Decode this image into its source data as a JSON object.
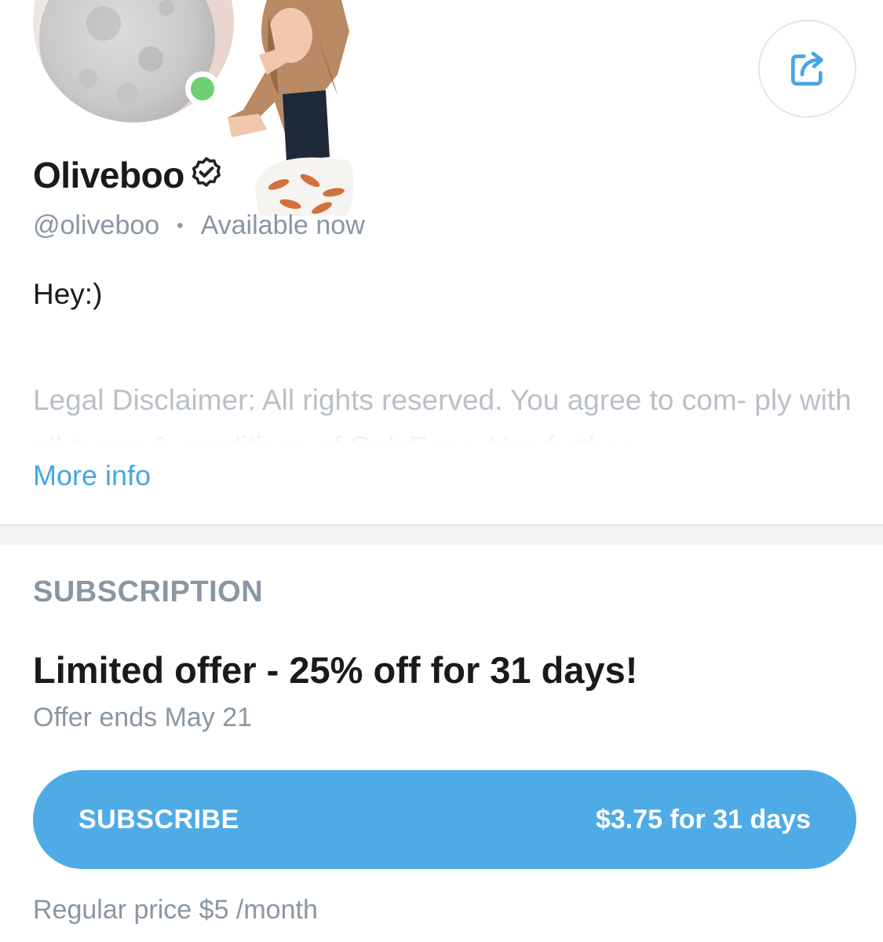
{
  "profile": {
    "name": "Oliveboo",
    "handle": "@oliveboo",
    "separator": "•",
    "status": "Available now",
    "bio": "Hey:)",
    "disclaimer": "Legal Disclaimer: All rights reserved. You agree to com- ply with all terms & conditions of OnlyFans. You further",
    "more_info": "More info"
  },
  "subscription": {
    "section_title": "SUBSCRIPTION",
    "offer_title": "Limited offer - 25% off for 31 days!",
    "offer_ends": "Offer ends May 21",
    "button_label": "SUBSCRIBE",
    "button_price": "$3.75 for 31 days",
    "regular_price": "Regular price $5 /month"
  },
  "colors": {
    "accent": "#4fabe6",
    "link": "#46a6e4",
    "muted": "#8a96a3",
    "online": "#6fcf72"
  },
  "icons": {
    "share": "share-icon",
    "verified": "verified-badge-icon"
  }
}
